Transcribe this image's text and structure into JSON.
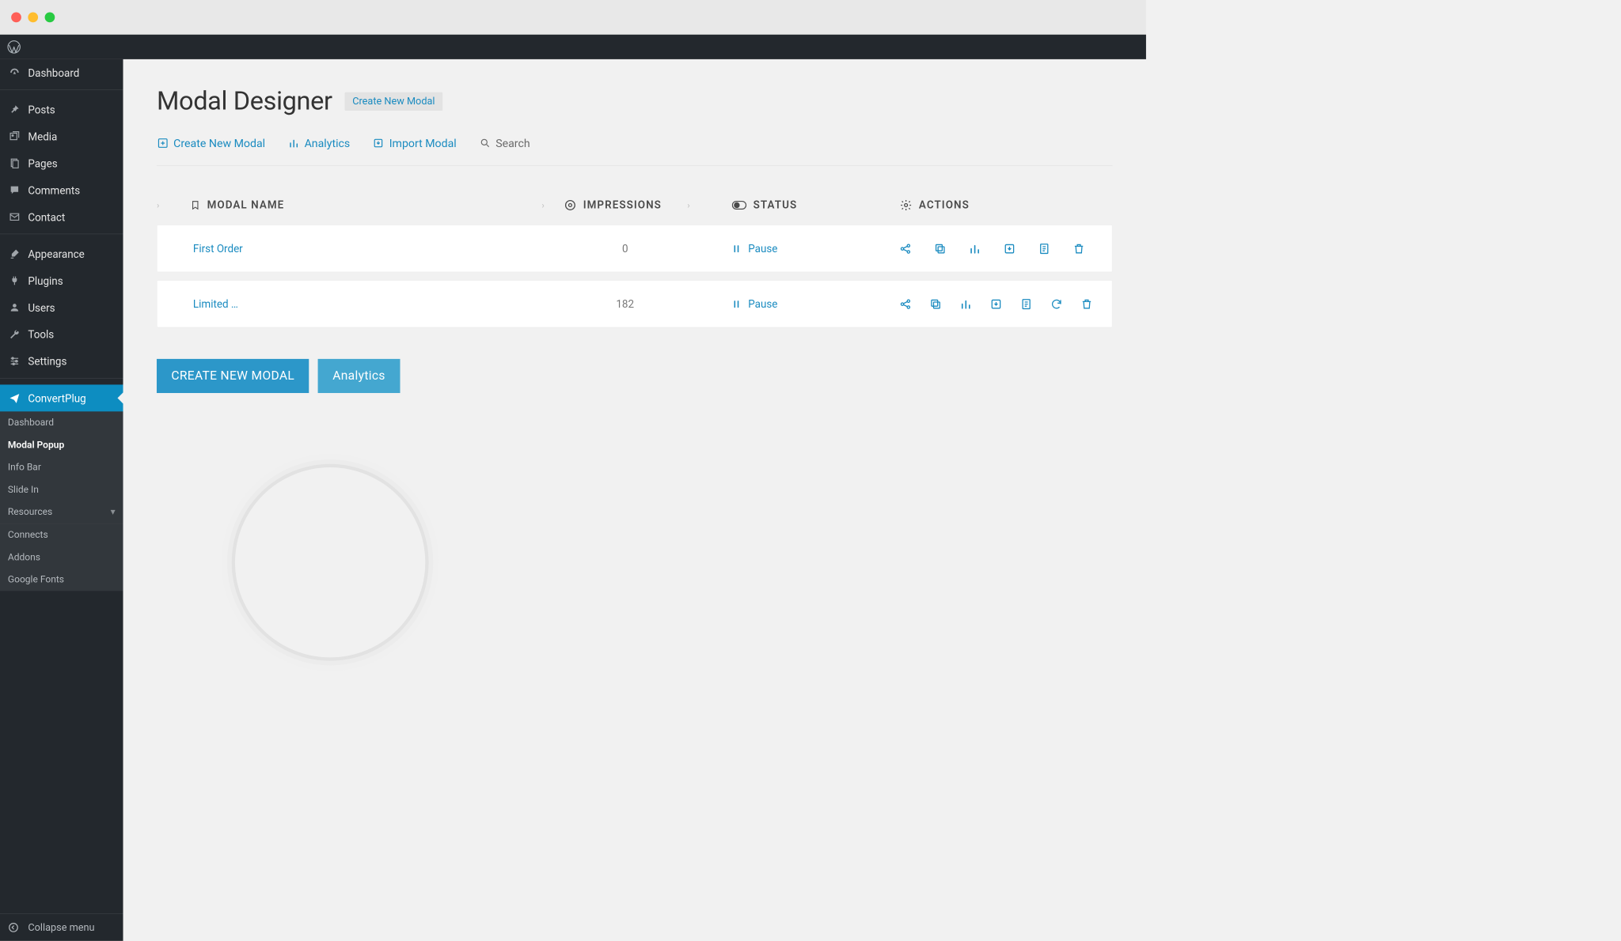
{
  "sidebar": {
    "items": [
      {
        "label": "Dashboard",
        "icon": "speedometer"
      },
      {
        "label": "Posts",
        "icon": "pin"
      },
      {
        "label": "Media",
        "icon": "media"
      },
      {
        "label": "Pages",
        "icon": "pages"
      },
      {
        "label": "Comments",
        "icon": "comment"
      },
      {
        "label": "Contact",
        "icon": "mail"
      }
    ],
    "items2": [
      {
        "label": "Appearance",
        "icon": "brush"
      },
      {
        "label": "Plugins",
        "icon": "plug"
      },
      {
        "label": "Users",
        "icon": "user"
      },
      {
        "label": "Tools",
        "icon": "wrench"
      },
      {
        "label": "Settings",
        "icon": "sliders"
      }
    ],
    "current": {
      "label": "ConvertPlug"
    },
    "submenu": [
      {
        "label": "Dashboard"
      },
      {
        "label": "Modal Popup",
        "active": true
      },
      {
        "label": "Info Bar"
      },
      {
        "label": "Slide In"
      },
      {
        "label": "Resources",
        "caret": true
      }
    ],
    "submenu2": [
      {
        "label": "Connects"
      },
      {
        "label": "Addons"
      },
      {
        "label": "Google Fonts"
      }
    ],
    "collapse": "Collapse menu"
  },
  "page": {
    "title": "Modal Designer",
    "title_action": "Create New Modal"
  },
  "toolbar": {
    "create": "Create New Modal",
    "analytics": "Analytics",
    "import": "Import Modal",
    "search": "Search"
  },
  "table": {
    "headers": {
      "name": "MODAL NAME",
      "impressions": "IMPRESSIONS",
      "status": "STATUS",
      "actions": "ACTIONS"
    },
    "rows": [
      {
        "name": "First Order",
        "impressions": "0",
        "status": "Pause",
        "actions": [
          "share",
          "copy",
          "analytics",
          "download",
          "notes",
          "trash"
        ]
      },
      {
        "name": "Limited …",
        "impressions": "182",
        "status": "Pause",
        "actions": [
          "share",
          "copy",
          "analytics",
          "download",
          "notes",
          "refresh",
          "trash"
        ]
      }
    ]
  },
  "buttons": {
    "create": "CREATE NEW MODAL",
    "analytics": "Analytics"
  }
}
